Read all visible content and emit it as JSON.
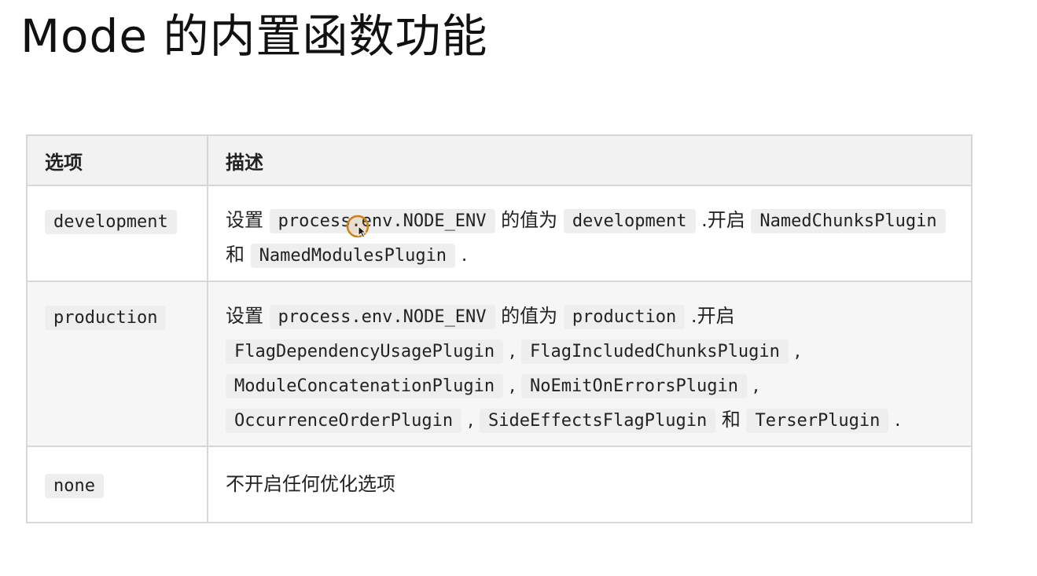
{
  "title": "Mode 的内置函数功能",
  "table": {
    "headers": {
      "option": "选项",
      "description": "描述"
    },
    "rows": [
      {
        "option": "development",
        "description": [
          {
            "t": "text",
            "v": "设置 "
          },
          {
            "t": "code",
            "v": "process.env.NODE_ENV"
          },
          {
            "t": "text",
            "v": " 的值为 "
          },
          {
            "t": "code",
            "v": "development"
          },
          {
            "t": "text",
            "v": " .开启 "
          },
          {
            "t": "code",
            "v": "NamedChunksPlugin"
          },
          {
            "t": "text",
            "v": " 和 "
          },
          {
            "t": "code",
            "v": "NamedModulesPlugin"
          },
          {
            "t": "text",
            "v": " ."
          }
        ]
      },
      {
        "option": "production",
        "description": [
          {
            "t": "text",
            "v": "设置 "
          },
          {
            "t": "code",
            "v": "process.env.NODE_ENV"
          },
          {
            "t": "text",
            "v": " 的值为 "
          },
          {
            "t": "code",
            "v": "production"
          },
          {
            "t": "text",
            "v": " .开启 "
          },
          {
            "t": "code",
            "v": "FlagDependencyUsagePlugin"
          },
          {
            "t": "text",
            "v": " , "
          },
          {
            "t": "code",
            "v": "FlagIncludedChunksPlugin"
          },
          {
            "t": "text",
            "v": " , "
          },
          {
            "t": "code",
            "v": "ModuleConcatenationPlugin"
          },
          {
            "t": "text",
            "v": " , "
          },
          {
            "t": "code",
            "v": "NoEmitOnErrorsPlugin"
          },
          {
            "t": "text",
            "v": " , "
          },
          {
            "t": "code",
            "v": "OccurrenceOrderPlugin"
          },
          {
            "t": "text",
            "v": " , "
          },
          {
            "t": "code",
            "v": "SideEffectsFlagPlugin"
          },
          {
            "t": "text",
            "v": " 和 "
          },
          {
            "t": "code",
            "v": "TerserPlugin"
          },
          {
            "t": "text",
            "v": " ."
          }
        ]
      },
      {
        "option": "none",
        "description": [
          {
            "t": "text",
            "v": "不开启任何优化选项"
          }
        ]
      }
    ]
  },
  "colors": {
    "header_bg": "#f2f2f2",
    "code_bg": "#eeeeee",
    "border": "#d7d7d7",
    "cursor_ring": "#c8821e"
  },
  "cursor_icon": "mouse-pointer-icon"
}
